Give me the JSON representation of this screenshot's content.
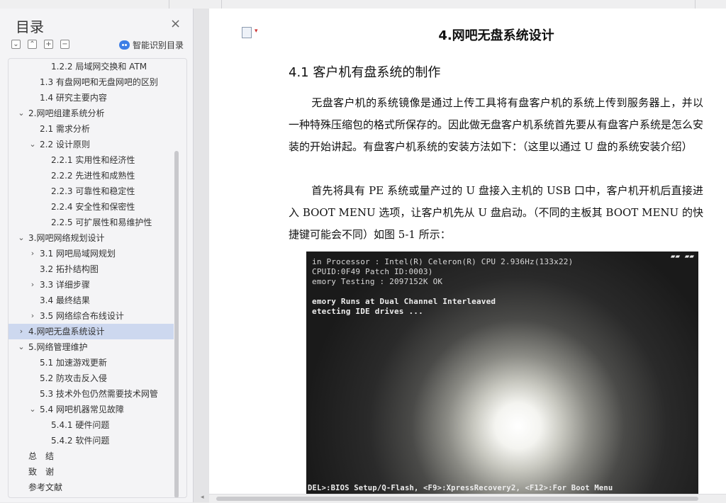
{
  "sidebar": {
    "title": "目录",
    "close_glyph": "×",
    "tools": [
      "⌄",
      "⌃",
      "+",
      "−"
    ],
    "smart_toc_label": "智能识别目录",
    "items": [
      {
        "label": "1.2.2 局域网交换和 ATM",
        "level": 3,
        "arrow": ""
      },
      {
        "label": "1.3 有盘网吧和无盘网吧的区别",
        "level": 2,
        "arrow": ""
      },
      {
        "label": "1.4 研究主要内容",
        "level": 2,
        "arrow": ""
      },
      {
        "label": "2.网吧组建系统分析",
        "level": 1,
        "arrow": "down"
      },
      {
        "label": "2.1 需求分析",
        "level": 2,
        "arrow": ""
      },
      {
        "label": "2.2 设计原则",
        "level": 2,
        "arrow": "down"
      },
      {
        "label": "2.2.1 实用性和经济性",
        "level": 3,
        "arrow": ""
      },
      {
        "label": "2.2.2 先进性和成熟性",
        "level": 3,
        "arrow": ""
      },
      {
        "label": "2.2.3 可靠性和稳定性",
        "level": 3,
        "arrow": ""
      },
      {
        "label": "2.2.4 安全性和保密性",
        "level": 3,
        "arrow": ""
      },
      {
        "label": "2.2.5 可扩展性和易维护性",
        "level": 3,
        "arrow": ""
      },
      {
        "label": "3.网吧网络规划设计",
        "level": 1,
        "arrow": "down"
      },
      {
        "label": "3.1 网吧局域网规划",
        "level": 2,
        "arrow": "right"
      },
      {
        "label": "3.2 拓扑结构图",
        "level": 2,
        "arrow": ""
      },
      {
        "label": "3.3 详细步骤",
        "level": 2,
        "arrow": "right"
      },
      {
        "label": "3.4 最终结果",
        "level": 2,
        "arrow": ""
      },
      {
        "label": "3.5 网络综合布线设计",
        "level": 2,
        "arrow": "right"
      },
      {
        "label": "4.网吧无盘系统设计",
        "level": 1,
        "arrow": "right",
        "selected": true
      },
      {
        "label": "5.网络管理维护",
        "level": 1,
        "arrow": "down"
      },
      {
        "label": "5.1 加速游戏更新",
        "level": 2,
        "arrow": ""
      },
      {
        "label": "5.2 防攻击反入侵",
        "level": 2,
        "arrow": ""
      },
      {
        "label": "5.3 技术外包仍然需要技术网管",
        "level": 2,
        "arrow": ""
      },
      {
        "label": "5.4 网吧机器常见故障",
        "level": 2,
        "arrow": "down"
      },
      {
        "label": "5.4.1 硬件问题",
        "level": 3,
        "arrow": ""
      },
      {
        "label": "5.4.2 软件问题",
        "level": 3,
        "arrow": ""
      },
      {
        "label": "总　结",
        "level": 1,
        "arrow": "none"
      },
      {
        "label": "致　谢",
        "level": 1,
        "arrow": "none"
      },
      {
        "label": "参考文献",
        "level": 1,
        "arrow": "none"
      }
    ]
  },
  "document": {
    "heading1": "4.网吧无盘系统设计",
    "heading2": "4.1 客户机有盘系统的制作",
    "para1": "无盘客户机的系统镜像是通过上传工具将有盘客户机的系统上传到服务器上，并以一种特殊压缩包的格式所保存的。因此做无盘客户机系统首先要从有盘客户系统是怎么安装的开始讲起。有盘客户机系统的安装方法如下：（这里以通过 U 盘的系统安装介绍）",
    "para2": "首先将具有 PE 系统或量产过的 U 盘接入主机的 USB 口中，客户机开机后直接进入 BOOT MENU 选项，让客户机先从 U 盘启动。（不同的主板其 BOOT MENU 的快捷键可能会不同）如图 5-1 所示：",
    "photo": {
      "lines": [
        "in Processor : Intel(R) Celeron(R) CPU   2.936Hz(133x22)",
        "CPUID:0F49 Patch ID:0003)",
        "emory Testing : 2097152K OK",
        "emory Runs at Dual Channel Interleaved",
        "etecting IDE drives ...",
        "DEL>:BIOS Setup/Q-Flash, <F9>:XpressRecovery2, <F12>:For Boot Menu"
      ],
      "corner": "▰▰ ▰▰"
    }
  }
}
